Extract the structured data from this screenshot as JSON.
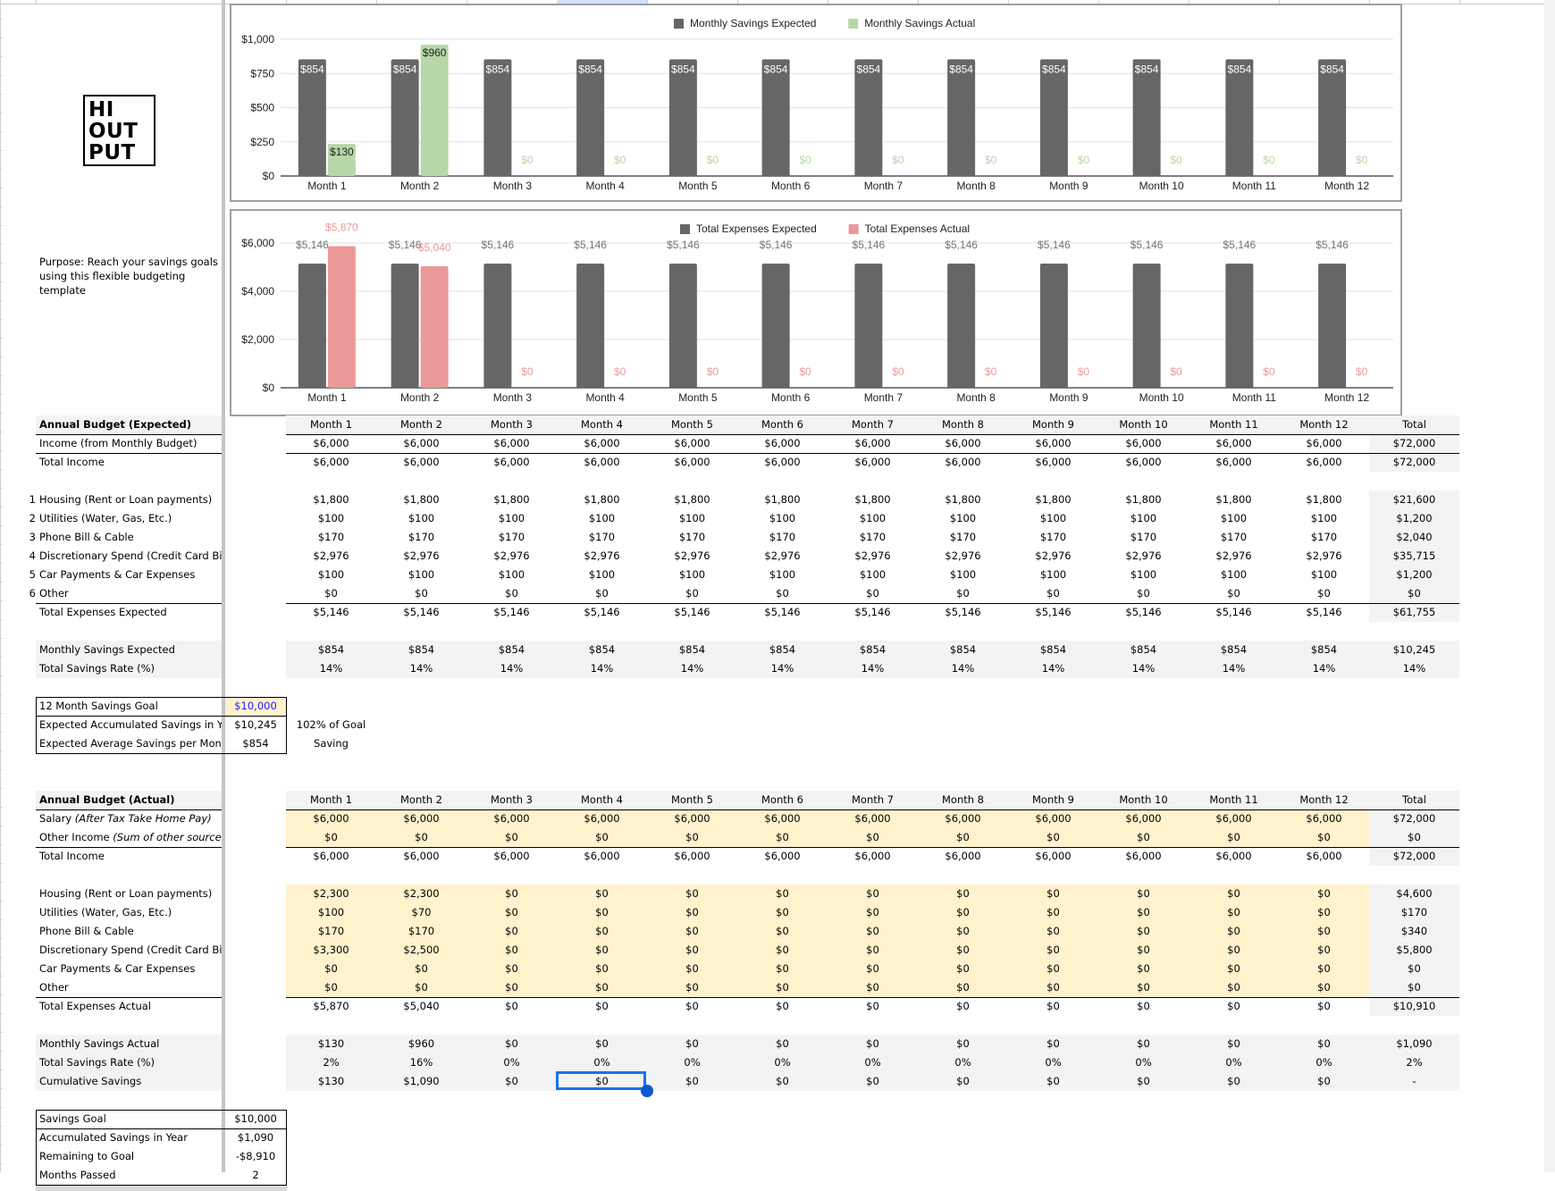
{
  "logo": {
    "lines": [
      "HI",
      "OUT",
      "PUT"
    ]
  },
  "purpose": "Purpose: Reach your savings goals using this flexible budgeting template",
  "months": [
    "Month 1",
    "Month 2",
    "Month 3",
    "Month 4",
    "Month 5",
    "Month 6",
    "Month 7",
    "Month 8",
    "Month 9",
    "Month 10",
    "Month 11",
    "Month 12"
  ],
  "total_label": "Total",
  "chart_data": [
    {
      "type": "bar",
      "title": "",
      "categories": [
        "Month 1",
        "Month 2",
        "Month 3",
        "Month 4",
        "Month 5",
        "Month 6",
        "Month 7",
        "Month 8",
        "Month 9",
        "Month 10",
        "Month 11",
        "Month 12"
      ],
      "series": [
        {
          "name": "Monthly Savings Expected",
          "color": "#666666",
          "values": [
            854,
            854,
            854,
            854,
            854,
            854,
            854,
            854,
            854,
            854,
            854,
            854
          ],
          "labels": [
            "$854",
            "$854",
            "$854",
            "$854",
            "$854",
            "$854",
            "$854",
            "$854",
            "$854",
            "$854",
            "$854",
            "$854"
          ]
        },
        {
          "name": "Monthly Savings Actual",
          "color": "#b6d7a8",
          "values": [
            130,
            960,
            0,
            0,
            0,
            0,
            0,
            0,
            0,
            0,
            0,
            0
          ],
          "labels": [
            "$130",
            "$960",
            "$0",
            "$0",
            "$0",
            "$0",
            "$0",
            "$0",
            "$0",
            "$0",
            "$0",
            "$0"
          ]
        }
      ],
      "yticks": [
        "$0",
        "$250",
        "$500",
        "$750",
        "$1,000"
      ],
      "ytick_values": [
        0,
        250,
        500,
        750,
        1000
      ],
      "ylim": [
        0,
        1000
      ],
      "xlabel": "",
      "ylabel": "",
      "legend": "top-center",
      "grid": true
    },
    {
      "type": "bar",
      "title": "",
      "categories": [
        "Month 1",
        "Month 2",
        "Month 3",
        "Month 4",
        "Month 5",
        "Month 6",
        "Month 7",
        "Month 8",
        "Month 9",
        "Month 10",
        "Month 11",
        "Month 12"
      ],
      "series": [
        {
          "name": "Total Expenses Expected",
          "color": "#666666",
          "values": [
            5146,
            5146,
            5146,
            5146,
            5146,
            5146,
            5146,
            5146,
            5146,
            5146,
            5146,
            5146
          ],
          "labels": [
            "$5,146",
            "$5,146",
            "$5,146",
            "$5,146",
            "$5,146",
            "$5,146",
            "$5,146",
            "$5,146",
            "$5,146",
            "$5,146",
            "$5,146",
            "$5,146"
          ]
        },
        {
          "name": "Total Expenses Actual",
          "color": "#ea9999",
          "values": [
            5870,
            5040,
            0,
            0,
            0,
            0,
            0,
            0,
            0,
            0,
            0,
            0
          ],
          "labels": [
            "$5,870",
            "$5,040",
            "$0",
            "$0",
            "$0",
            "$0",
            "$0",
            "$0",
            "$0",
            "$0",
            "$0",
            "$0"
          ]
        }
      ],
      "yticks": [
        "$0",
        "$2,000",
        "$4,000",
        "$6,000"
      ],
      "ytick_values": [
        0,
        2000,
        4000,
        6000
      ],
      "ylim": [
        0,
        6000
      ],
      "xlabel": "",
      "ylabel": "",
      "legend": "top-center",
      "grid": true
    }
  ],
  "expected": {
    "header": "Annual Budget (Expected)",
    "income_rows": [
      {
        "label": "Income (from Monthly Budget)",
        "values": [
          "$6,000",
          "$6,000",
          "$6,000",
          "$6,000",
          "$6,000",
          "$6,000",
          "$6,000",
          "$6,000",
          "$6,000",
          "$6,000",
          "$6,000",
          "$6,000"
        ],
        "total": "$72,000"
      },
      {
        "label": "Total Income",
        "values": [
          "$6,000",
          "$6,000",
          "$6,000",
          "$6,000",
          "$6,000",
          "$6,000",
          "$6,000",
          "$6,000",
          "$6,000",
          "$6,000",
          "$6,000",
          "$6,000"
        ],
        "total": "$72,000"
      }
    ],
    "expense_rows": [
      {
        "num": "1",
        "label": "Housing (Rent or Loan payments)",
        "values": [
          "$1,800",
          "$1,800",
          "$1,800",
          "$1,800",
          "$1,800",
          "$1,800",
          "$1,800",
          "$1,800",
          "$1,800",
          "$1,800",
          "$1,800",
          "$1,800"
        ],
        "total": "$21,600"
      },
      {
        "num": "2",
        "label": "Utilities (Water, Gas, Etc.)",
        "values": [
          "$100",
          "$100",
          "$100",
          "$100",
          "$100",
          "$100",
          "$100",
          "$100",
          "$100",
          "$100",
          "$100",
          "$100"
        ],
        "total": "$1,200"
      },
      {
        "num": "3",
        "label": "Phone Bill & Cable",
        "values": [
          "$170",
          "$170",
          "$170",
          "$170",
          "$170",
          "$170",
          "$170",
          "$170",
          "$170",
          "$170",
          "$170",
          "$170"
        ],
        "total": "$2,040"
      },
      {
        "num": "4",
        "label": "Discretionary Spend (Credit Card Bill)",
        "values": [
          "$2,976",
          "$2,976",
          "$2,976",
          "$2,976",
          "$2,976",
          "$2,976",
          "$2,976",
          "$2,976",
          "$2,976",
          "$2,976",
          "$2,976",
          "$2,976"
        ],
        "total": "$35,715"
      },
      {
        "num": "5",
        "label": "Car Payments & Car Expenses",
        "values": [
          "$100",
          "$100",
          "$100",
          "$100",
          "$100",
          "$100",
          "$100",
          "$100",
          "$100",
          "$100",
          "$100",
          "$100"
        ],
        "total": "$1,200"
      },
      {
        "num": "6",
        "label": "Other",
        "values": [
          "$0",
          "$0",
          "$0",
          "$0",
          "$0",
          "$0",
          "$0",
          "$0",
          "$0",
          "$0",
          "$0",
          "$0"
        ],
        "total": "$0"
      }
    ],
    "total_expenses": {
      "label": "Total Expenses Expected",
      "values": [
        "$5,146",
        "$5,146",
        "$5,146",
        "$5,146",
        "$5,146",
        "$5,146",
        "$5,146",
        "$5,146",
        "$5,146",
        "$5,146",
        "$5,146",
        "$5,146"
      ],
      "total": "$61,755"
    },
    "savings_rows": [
      {
        "label": "Monthly Savings Expected",
        "values": [
          "$854",
          "$854",
          "$854",
          "$854",
          "$854",
          "$854",
          "$854",
          "$854",
          "$854",
          "$854",
          "$854",
          "$854"
        ],
        "total": "$10,245"
      },
      {
        "label": "Total Savings Rate (%)",
        "values": [
          "14%",
          "14%",
          "14%",
          "14%",
          "14%",
          "14%",
          "14%",
          "14%",
          "14%",
          "14%",
          "14%",
          "14%"
        ],
        "total": "14%"
      }
    ],
    "goal_box": [
      {
        "label": "12 Month Savings Goal",
        "value": "$10,000"
      },
      {
        "label": "Expected Accumulated Savings in Year",
        "value": "$10,245"
      },
      {
        "label": "Expected Average Savings per Month",
        "value": "$854"
      }
    ],
    "goal_note_1": "102% of Goal",
    "goal_note_2": "Saving"
  },
  "actual": {
    "header": "Annual Budget (Actual)",
    "income_rows": [
      {
        "label": "Salary",
        "label_italic": "(After Tax Take Home Pay)",
        "values": [
          "$6,000",
          "$6,000",
          "$6,000",
          "$6,000",
          "$6,000",
          "$6,000",
          "$6,000",
          "$6,000",
          "$6,000",
          "$6,000",
          "$6,000",
          "$6,000"
        ],
        "total": "$72,000"
      },
      {
        "label": "Other Income",
        "label_italic": "(Sum of other sources)",
        "values": [
          "$0",
          "$0",
          "$0",
          "$0",
          "$0",
          "$0",
          "$0",
          "$0",
          "$0",
          "$0",
          "$0",
          "$0"
        ],
        "total": "$0"
      }
    ],
    "total_income": {
      "label": "Total Income",
      "values": [
        "$6,000",
        "$6,000",
        "$6,000",
        "$6,000",
        "$6,000",
        "$6,000",
        "$6,000",
        "$6,000",
        "$6,000",
        "$6,000",
        "$6,000",
        "$6,000"
      ],
      "total": "$72,000"
    },
    "expense_rows": [
      {
        "label": "Housing (Rent or Loan payments)",
        "values": [
          "$2,300",
          "$2,300",
          "$0",
          "$0",
          "$0",
          "$0",
          "$0",
          "$0",
          "$0",
          "$0",
          "$0",
          "$0"
        ],
        "total": "$4,600"
      },
      {
        "label": "Utilities (Water, Gas, Etc.)",
        "values": [
          "$100",
          "$70",
          "$0",
          "$0",
          "$0",
          "$0",
          "$0",
          "$0",
          "$0",
          "$0",
          "$0",
          "$0"
        ],
        "total": "$170"
      },
      {
        "label": "Phone Bill & Cable",
        "values": [
          "$170",
          "$170",
          "$0",
          "$0",
          "$0",
          "$0",
          "$0",
          "$0",
          "$0",
          "$0",
          "$0",
          "$0"
        ],
        "total": "$340"
      },
      {
        "label": "Discretionary Spend (Credit Card Bill)",
        "values": [
          "$3,300",
          "$2,500",
          "$0",
          "$0",
          "$0",
          "$0",
          "$0",
          "$0",
          "$0",
          "$0",
          "$0",
          "$0"
        ],
        "total": "$5,800"
      },
      {
        "label": "Car Payments & Car Expenses",
        "values": [
          "$0",
          "$0",
          "$0",
          "$0",
          "$0",
          "$0",
          "$0",
          "$0",
          "$0",
          "$0",
          "$0",
          "$0"
        ],
        "total": "$0"
      },
      {
        "label": "Other",
        "values": [
          "$0",
          "$0",
          "$0",
          "$0",
          "$0",
          "$0",
          "$0",
          "$0",
          "$0",
          "$0",
          "$0",
          "$0"
        ],
        "total": "$0"
      }
    ],
    "total_expenses": {
      "label": "Total Expenses Actual",
      "values": [
        "$5,870",
        "$5,040",
        "$0",
        "$0",
        "$0",
        "$0",
        "$0",
        "$0",
        "$0",
        "$0",
        "$0",
        "$0"
      ],
      "total": "$10,910"
    },
    "savings_rows": [
      {
        "label": "Monthly Savings Actual",
        "values": [
          "$130",
          "$960",
          "$0",
          "$0",
          "$0",
          "$0",
          "$0",
          "$0",
          "$0",
          "$0",
          "$0",
          "$0"
        ],
        "total": "$1,090"
      },
      {
        "label": "Total Savings Rate (%)",
        "values": [
          "2%",
          "16%",
          "0%",
          "0%",
          "0%",
          "0%",
          "0%",
          "0%",
          "0%",
          "0%",
          "0%",
          "0%"
        ],
        "total": "2%"
      },
      {
        "label": "Cumulative Savings",
        "values": [
          "$130",
          "$1,090",
          "$0",
          "$0",
          "$0",
          "$0",
          "$0",
          "$0",
          "$0",
          "$0",
          "$0",
          "$0"
        ],
        "total": "-"
      }
    ],
    "goal_box": [
      {
        "label": "Savings Goal",
        "value": "$10,000"
      },
      {
        "label": "Accumulated Savings in Year",
        "value": "$1,090"
      },
      {
        "label": "Remaining to Goal",
        "value": "-$8,910"
      },
      {
        "label": "Months Passed",
        "value": "2"
      }
    ]
  }
}
